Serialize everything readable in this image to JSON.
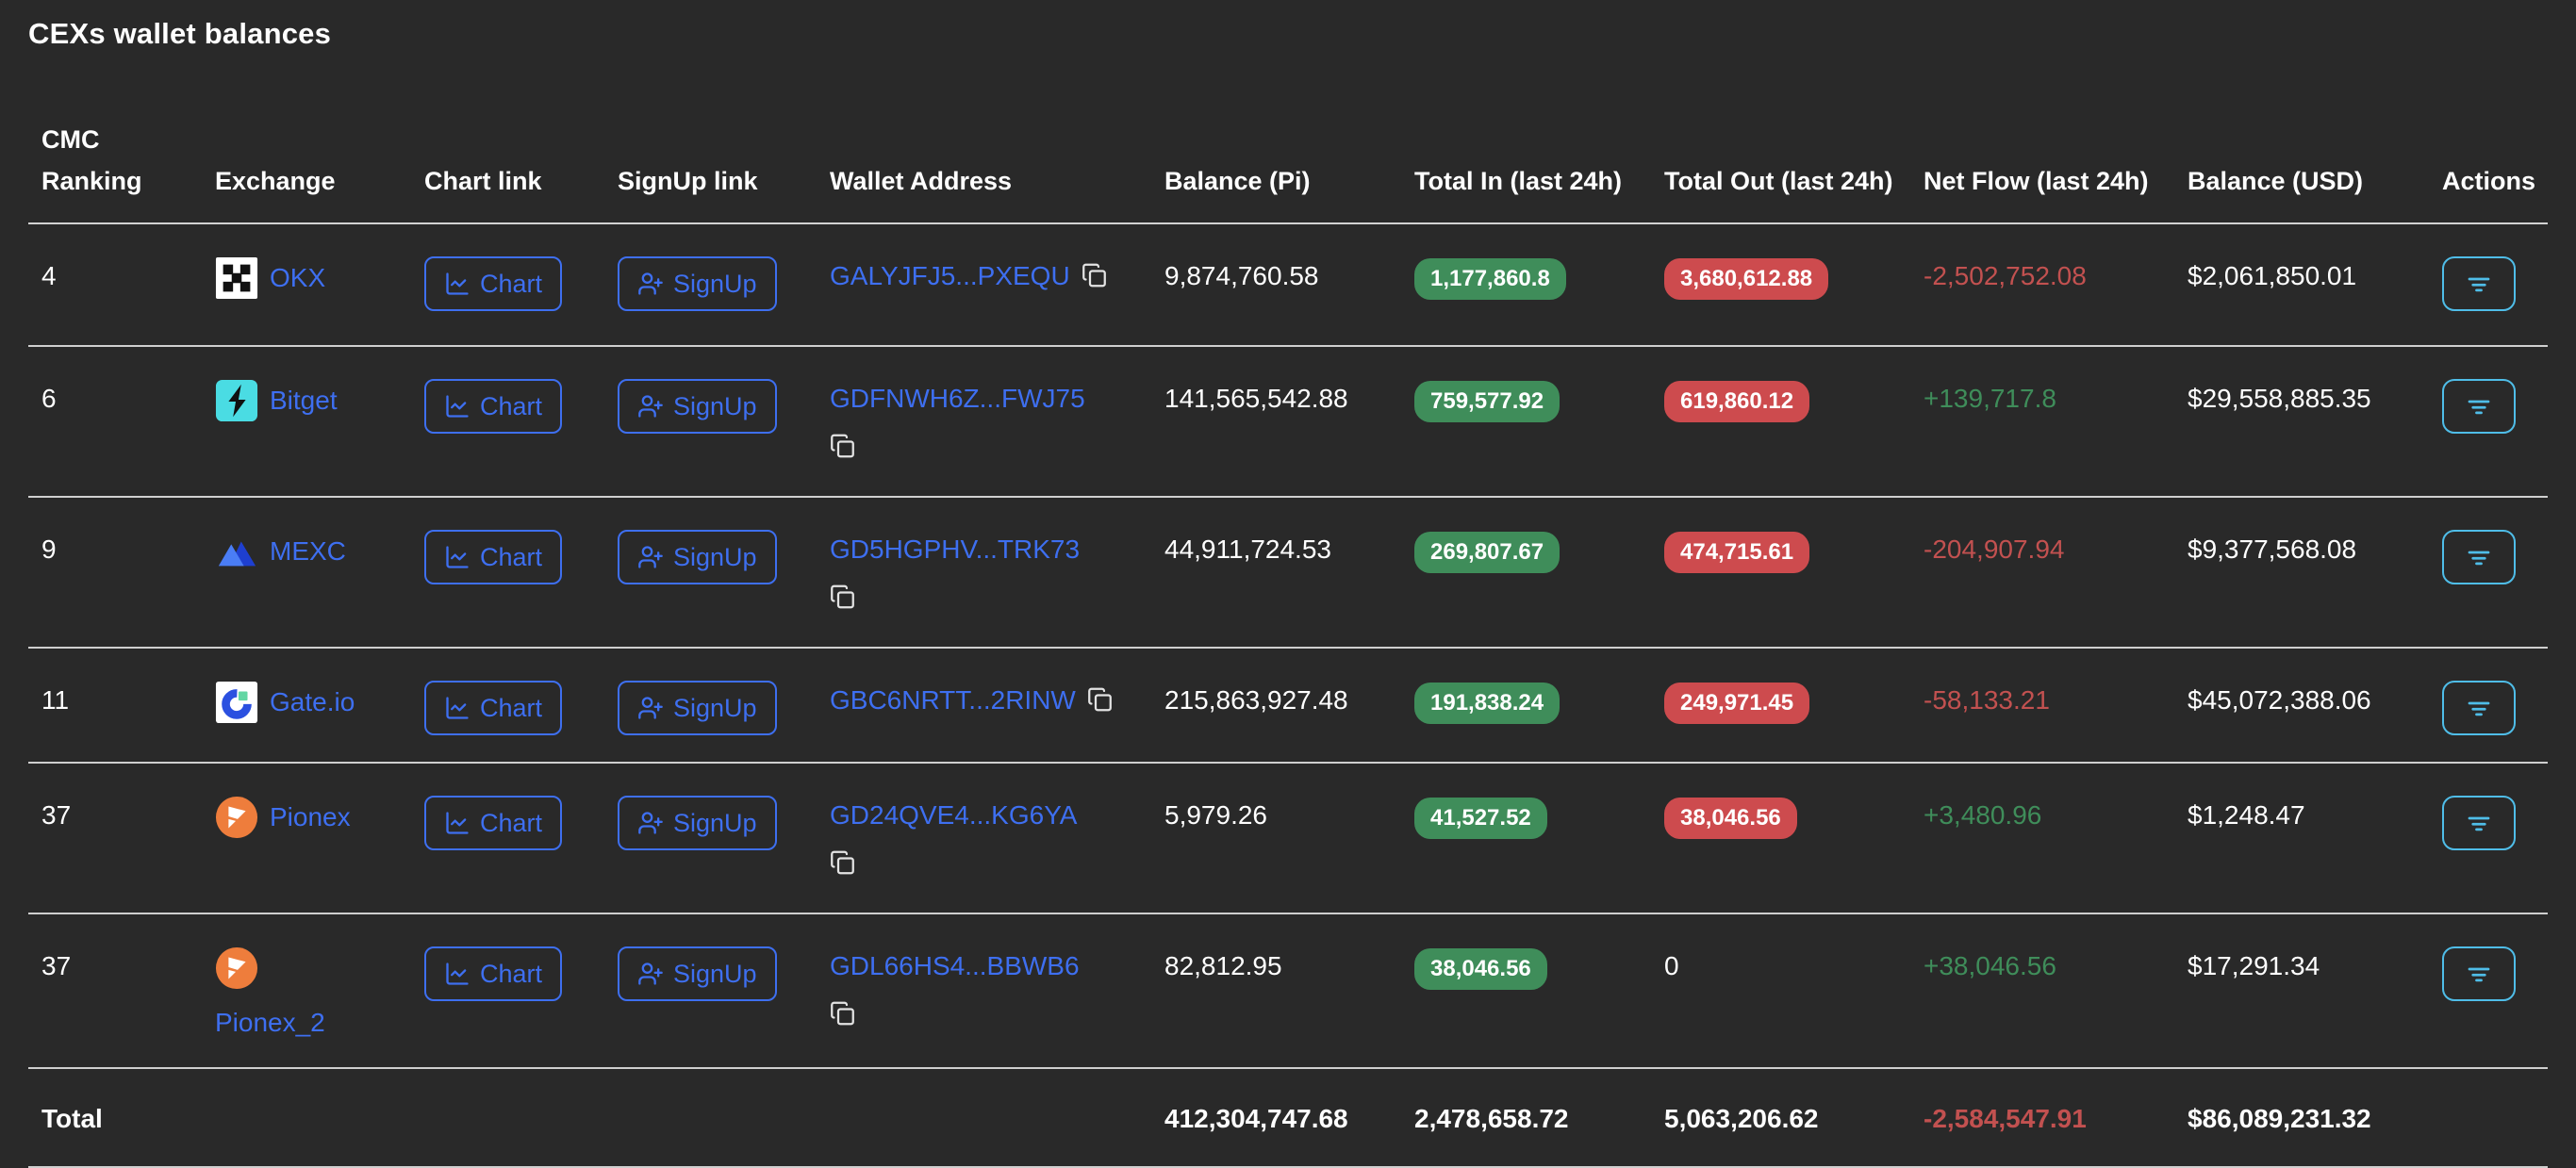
{
  "title": "CEXs wallet balances",
  "header": {
    "cmc_ranking": "CMC Ranking",
    "exchange": "Exchange",
    "chart_link": "Chart link",
    "signup_link": "SignUp link",
    "wallet_address": "Wallet Address",
    "balance_pi": "Balance (Pi)",
    "total_in": "Total In (last 24h)",
    "total_out": "Total Out (last 24h)",
    "net_flow": "Net Flow (last 24h)",
    "balance_usd": "Balance (USD)",
    "actions": "Actions"
  },
  "buttons": {
    "chart": "Chart",
    "signup": "SignUp"
  },
  "icons": {
    "chart_button": "line-chart-icon",
    "signup_button": "user-plus-icon",
    "wallet_copy": "copy-icon",
    "actions_button": "filter-icon",
    "exchange_logos": [
      "okx-logo",
      "bitget-logo",
      "mexc-logo",
      "gateio-logo",
      "pionex-logo",
      "pionex-logo"
    ]
  },
  "colors": {
    "background": "#292929",
    "link_blue": "#3e6ff0",
    "action_cyan": "#4fbde8",
    "badge_green": "#3f8d5a",
    "badge_red": "#cd4b4e",
    "flow_negative": "#c25150",
    "flow_positive": "#3f8d5a",
    "divider": "#cfcfcf"
  },
  "rows": [
    {
      "rank": "4",
      "exchange": "OKX",
      "wallet": "GALYJFJ5...PXEQU",
      "balance_pi": "9,874,760.58",
      "total_in": "1,177,860.8",
      "total_out": "3,680,612.88",
      "net_flow": "-2,502,752.08",
      "balance_usd": "$2,061,850.01"
    },
    {
      "rank": "6",
      "exchange": "Bitget",
      "wallet": "GDFNWH6Z...FWJ75",
      "balance_pi": "141,565,542.88",
      "total_in": "759,577.92",
      "total_out": "619,860.12",
      "net_flow": "+139,717.8",
      "balance_usd": "$29,558,885.35"
    },
    {
      "rank": "9",
      "exchange": "MEXC",
      "wallet": "GD5HGPHV...TRK73",
      "balance_pi": "44,911,724.53",
      "total_in": "269,807.67",
      "total_out": "474,715.61",
      "net_flow": "-204,907.94",
      "balance_usd": "$9,377,568.08"
    },
    {
      "rank": "11",
      "exchange": "Gate.io",
      "wallet": "GBC6NRTT...2RINW",
      "balance_pi": "215,863,927.48",
      "total_in": "191,838.24",
      "total_out": "249,971.45",
      "net_flow": "-58,133.21",
      "balance_usd": "$45,072,388.06"
    },
    {
      "rank": "37",
      "exchange": "Pionex",
      "wallet": "GD24QVE4...KG6YA",
      "balance_pi": "5,979.26",
      "total_in": "41,527.52",
      "total_out": "38,046.56",
      "net_flow": "+3,480.96",
      "balance_usd": "$1,248.47"
    },
    {
      "rank": "37",
      "exchange": "Pionex_2",
      "wallet": "GDL66HS4...BBWB6",
      "balance_pi": "82,812.95",
      "total_in": "38,046.56",
      "total_out": "0",
      "net_flow": "+38,046.56",
      "balance_usd": "$17,291.34"
    }
  ],
  "total": {
    "label": "Total",
    "balance_pi": "412,304,747.68",
    "total_in": "2,478,658.72",
    "total_out": "5,063,206.62",
    "net_flow": "-2,584,547.91",
    "balance_usd": "$86,089,231.32"
  }
}
